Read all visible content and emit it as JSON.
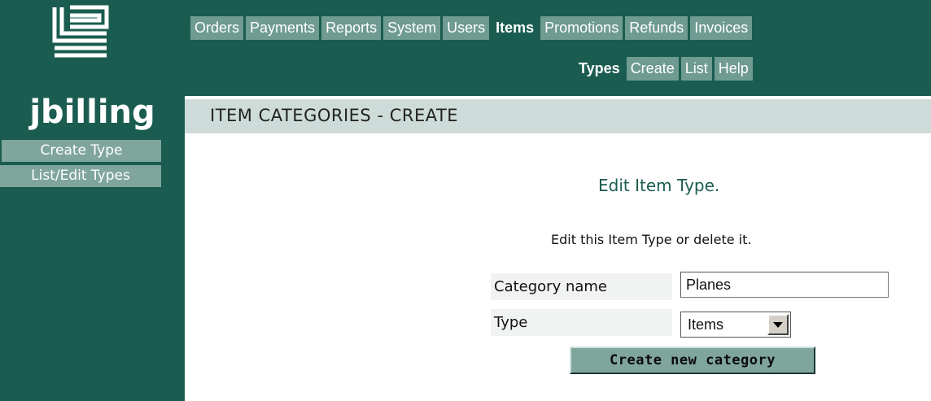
{
  "brand": {
    "name": "jbilling",
    "logo_icon": "jbilling-logo-icon"
  },
  "colors": {
    "primary": "#1a5c50",
    "tab": "#6f9b91",
    "title_bar": "#cddcd8",
    "button": "#7fa59c"
  },
  "main_nav": {
    "tabs": [
      {
        "label": "Orders",
        "active": false
      },
      {
        "label": "Payments",
        "active": false
      },
      {
        "label": "Reports",
        "active": false
      },
      {
        "label": "System",
        "active": false
      },
      {
        "label": "Users",
        "active": false
      },
      {
        "label": "Items",
        "active": true
      },
      {
        "label": "Promotions",
        "active": false
      },
      {
        "label": "Refunds",
        "active": false
      },
      {
        "label": "Invoices",
        "active": false
      }
    ]
  },
  "sub_nav": {
    "tabs": [
      {
        "label": "Types",
        "active": true
      },
      {
        "label": "Create",
        "active": false
      },
      {
        "label": "List",
        "active": false
      },
      {
        "label": "Help",
        "active": false
      }
    ]
  },
  "sidebar": {
    "items": [
      {
        "label": "Create Type"
      },
      {
        "label": "List/Edit Types"
      }
    ]
  },
  "page": {
    "title": "ITEM CATEGORIES - CREATE",
    "heading": "Edit Item Type.",
    "instructions": "Edit this Item Type or delete it."
  },
  "form": {
    "category_name_label": "Category name",
    "category_name_value": "Planes",
    "type_label": "Type",
    "type_selected": "Items",
    "submit_label": "Create new category"
  }
}
